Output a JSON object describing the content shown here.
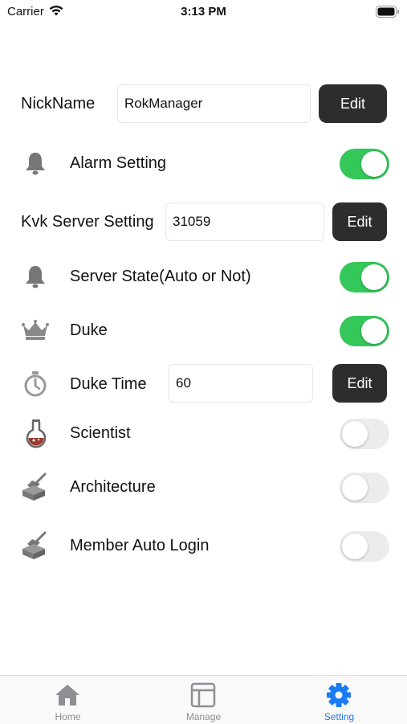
{
  "status_bar": {
    "carrier": "Carrier",
    "time": "3:13 PM"
  },
  "colors": {
    "toggle_on": "#34c759",
    "toggle_off": "#ececec",
    "button": "#2d2d2d",
    "tab_active": "#1a7cf5",
    "tab_inactive": "#8e8e93"
  },
  "settings": {
    "nickname": {
      "label": "NickName",
      "value": "RokManager",
      "button": "Edit"
    },
    "alarm": {
      "label": "Alarm Setting",
      "icon": "bell-icon",
      "on": true
    },
    "kvk_server": {
      "label": "Kvk Server Setting",
      "value": "31059",
      "button": "Edit"
    },
    "server_state": {
      "label": "Server State(Auto or Not)",
      "icon": "bell-icon",
      "on": true
    },
    "duke": {
      "label": "Duke",
      "icon": "crown-icon",
      "on": true
    },
    "duke_time": {
      "label": "Duke Time",
      "icon": "timer-icon",
      "value": "60",
      "button": "Edit"
    },
    "scientist": {
      "label": "Scientist",
      "icon": "flask-icon",
      "on": false
    },
    "architecture": {
      "label": "Architecture",
      "icon": "trowel-brick-icon",
      "on": false
    },
    "member_auto_login": {
      "label": "Member Auto Login",
      "icon": "trowel-brick-icon",
      "on": false
    }
  },
  "tabbar": {
    "tabs": [
      {
        "label": "Home",
        "icon": "house-icon",
        "active": false
      },
      {
        "label": "Manage",
        "icon": "window-icon",
        "active": false
      },
      {
        "label": "Setting",
        "icon": "gear-icon",
        "active": true
      }
    ]
  }
}
